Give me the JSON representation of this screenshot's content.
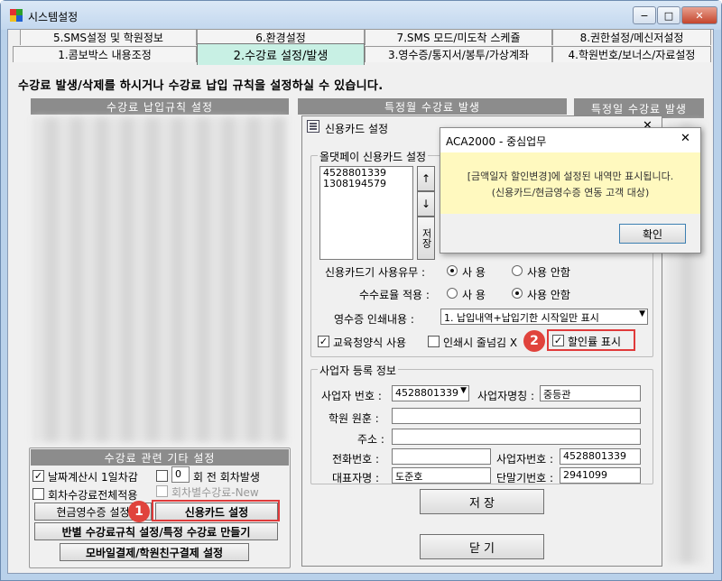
{
  "window": {
    "title": "시스템설정",
    "min": "−",
    "max": "□",
    "close": "✕"
  },
  "tabs": {
    "row1": [
      "5.SMS설정 및 학원정보",
      "6.환경설정",
      "7.SMS 모드/미도착 스케쥴",
      "8.권한설정/메신저설정"
    ],
    "row2": [
      "1.콤보박스 내용조정",
      "2.수강료 설정/발생",
      "3.영수증/통지서/봉투/가상계좌",
      "4.학원번호/보너스/자료설정"
    ]
  },
  "info_text": "수강료 발생/삭제를 하시거나 수강료 납입 규칙을 설정하실 수 있습니다.",
  "panels": {
    "left": "수강료 납입규칙 설정",
    "mid": "특정월 수강료 발생",
    "right": "특정일 수강료 발생"
  },
  "other": {
    "title": "수강료 관련 기타 설정",
    "chk_daycalc": "날짜계산시 1일차감",
    "times_value": "0",
    "times_label": "회 전  회차발생",
    "chk_overall": "회차수강료전체적용",
    "chk_new": "회차별수강료-New",
    "btn_cash": "현금영수증 설정",
    "btn_card": "신용카드 설정",
    "btn_class": "반별 수강료규칙 설정/특정 수강료 만들기",
    "btn_mobile": "모바일결제/학원친구결제 설정"
  },
  "card_dialog": {
    "title": "신용카드 설정",
    "group1": "올댓페이 신용카드 설정",
    "list": [
      "4528801339",
      "1308194579"
    ],
    "up": "↑",
    "down": "↓",
    "save_side": "저장",
    "use_label": "신용카드기 사용유무 :",
    "use_on": "사  용",
    "use_off": "사용 안함",
    "fee_label": "수수료율 적용 :",
    "fee_on": "사  용",
    "fee_off": "사용 안함",
    "print_label": "영수증 인쇄내용 :",
    "print_value": "1. 납입내역+납입기한 시작일만 표시",
    "chk_edu": "교육청양식 사용",
    "chk_reduce": "인쇄시 줄넘김 X",
    "chk_discount": "할인률 표시",
    "group2": "사업자 등록 정보",
    "biz_no_label": "사업자 번호 :",
    "biz_no_value": "4528801339",
    "biz_name_label": "사업자명칭 :",
    "biz_name_value": "중등관",
    "academy_label": "학원 원훈 :",
    "addr_label": "주소 :",
    "phone_label": "전화번호 :",
    "biz_no2_label": "사업자번호 :",
    "biz_no2_value": "4528801339",
    "ceo_label": "대표자명 :",
    "ceo_value": "도준호",
    "terminal_label": "단말기번호 :",
    "terminal_value": "2941099",
    "save_btn": "저  장",
    "close_btn": "닫  기"
  },
  "message": {
    "title": "ACA2000 - 중심업무",
    "line1": "[금액일자 할인변경]에 설정된 내역만 표시됩니다.",
    "line2": "(신용카드/현금영수증 연동 고객 대상)",
    "ok": "확인",
    "close": "✕"
  },
  "badges": {
    "one": "1",
    "two": "2"
  }
}
